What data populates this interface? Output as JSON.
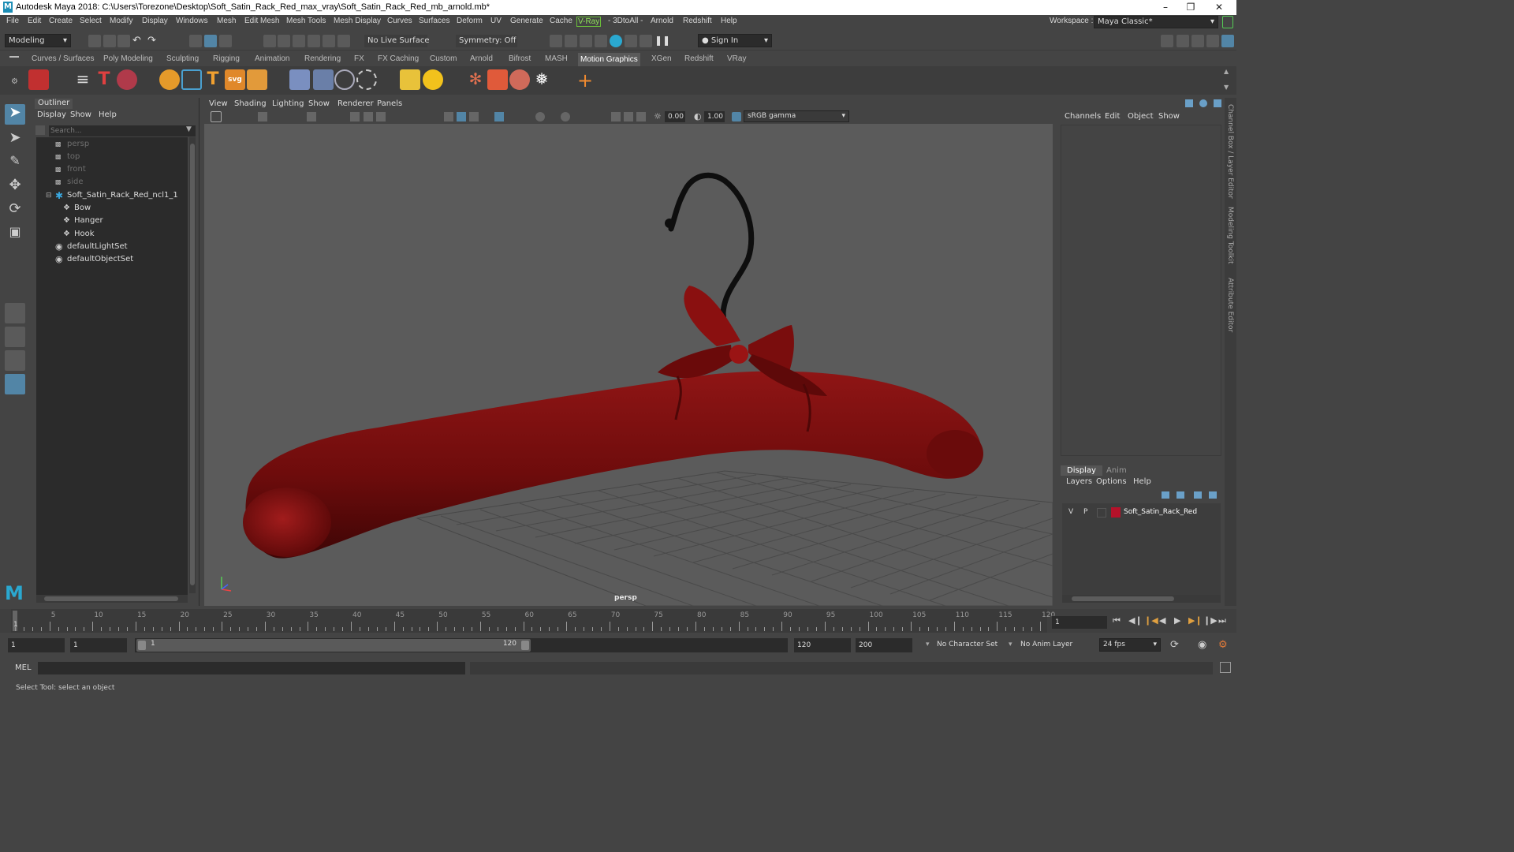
{
  "window": {
    "title": "Autodesk Maya 2018: C:\\Users\\Torezone\\Desktop\\Soft_Satin_Rack_Red_max_vray\\Soft_Satin_Rack_Red_mb_arnold.mb*",
    "logo_letter": "M"
  },
  "menubar": {
    "items": [
      "File",
      "Edit",
      "Create",
      "Select",
      "Modify",
      "Display",
      "Windows",
      "Mesh",
      "Edit Mesh",
      "Mesh Tools",
      "Mesh Display",
      "Curves",
      "Surfaces",
      "Deform",
      "UV",
      "Generate",
      "Cache",
      "V-Ray",
      "- 3DtoAll -",
      "Arnold",
      "Redshift",
      "Help"
    ],
    "workspace_label": "Workspace :",
    "workspace_value": "Maya Classic*"
  },
  "statusline": {
    "mode": "Modeling",
    "live_surface": "No Live Surface",
    "symmetry": "Symmetry: Off",
    "sign_in": "Sign In"
  },
  "shelf": {
    "tabs": [
      "Curves / Surfaces",
      "Poly Modeling",
      "Sculpting",
      "Rigging",
      "Animation",
      "Rendering",
      "FX",
      "FX Caching",
      "Custom",
      "Arnold",
      "Bifrost",
      "MASH",
      "Motion Graphics",
      "XGen",
      "Redshift",
      "VRay"
    ],
    "active_tab": "Motion Graphics",
    "svg_label": "svg"
  },
  "outliner": {
    "title": "Outliner",
    "menu": [
      "Display",
      "Show",
      "Help"
    ],
    "search_placeholder": "Search...",
    "items": [
      {
        "label": "persp",
        "dim": true,
        "indent": 0
      },
      {
        "label": "top",
        "dim": true,
        "indent": 0
      },
      {
        "label": "front",
        "dim": true,
        "indent": 0
      },
      {
        "label": "side",
        "dim": true,
        "indent": 0
      },
      {
        "label": "Soft_Satin_Rack_Red_ncl1_1",
        "dim": false,
        "indent": 0
      },
      {
        "label": "Bow",
        "dim": false,
        "indent": 1
      },
      {
        "label": "Hanger",
        "dim": false,
        "indent": 1
      },
      {
        "label": "Hook",
        "dim": false,
        "indent": 1
      },
      {
        "label": "defaultLightSet",
        "dim": false,
        "indent": 0
      },
      {
        "label": "defaultObjectSet",
        "dim": false,
        "indent": 0
      }
    ]
  },
  "viewport": {
    "menu": [
      "View",
      "Shading",
      "Lighting",
      "Show",
      "Renderer",
      "Panels"
    ],
    "exposure": "0.00",
    "gamma": "1.00",
    "color_space": "sRGB gamma",
    "camera_label": "persp"
  },
  "channelbox": {
    "menu": [
      "Channels",
      "Edit",
      "Object",
      "Show"
    ],
    "tabs": [
      "Display",
      "Anim"
    ],
    "layer_menu": [
      "Layers",
      "Options",
      "Help"
    ],
    "layer": {
      "v": "V",
      "p": "P",
      "name": "Soft_Satin_Rack_Red",
      "color": "#b5122a"
    },
    "side_tabs": [
      "Channel Box / Layer Editor",
      "Modeling Toolkit",
      "Attribute Editor"
    ]
  },
  "timeslider": {
    "labels": [
      "5",
      "10",
      "15",
      "20",
      "25",
      "30",
      "35",
      "40",
      "45",
      "50",
      "55",
      "60",
      "65",
      "70",
      "75",
      "80",
      "85",
      "90",
      "95",
      "100",
      "105",
      "110",
      "115",
      "120"
    ],
    "current_marker": "1",
    "current_frame": "1"
  },
  "rangeslider": {
    "start": "1",
    "inner_start": "1",
    "slider_start": "1",
    "slider_end": "120",
    "end": "120",
    "total_end": "200",
    "character_set": "No Character Set",
    "anim_layer": "No Anim Layer",
    "fps": "24 fps"
  },
  "commandline": {
    "lang": "MEL"
  },
  "helpline": {
    "text": "Select Tool: select an object"
  },
  "colors": {
    "hanger": "#7a0e0e",
    "accent": "#5285a6"
  }
}
